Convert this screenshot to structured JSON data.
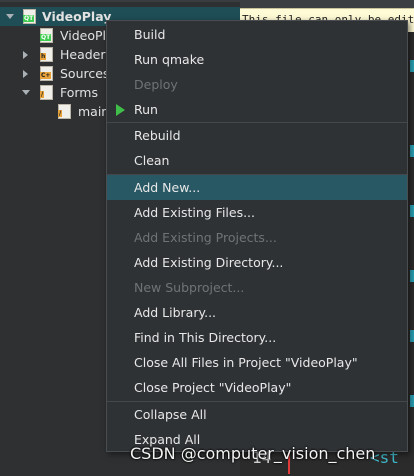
{
  "tree": {
    "project": "VideoPlay",
    "items": [
      {
        "label": "VideoPlay",
        "icon": "pro-file-icon"
      },
      {
        "label": "Headers",
        "icon": "headers-folder-icon"
      },
      {
        "label": "Sources",
        "icon": "sources-folder-icon"
      },
      {
        "label": "Forms",
        "icon": "forms-folder-icon"
      },
      {
        "label": "main",
        "icon": "ui-file-icon"
      }
    ]
  },
  "editor": {
    "banner": "This file can only be edited",
    "line_number": "14",
    "code_fragment": "<st"
  },
  "menu": {
    "items": [
      {
        "label": "Build",
        "enabled": true
      },
      {
        "label": "Run qmake",
        "enabled": true
      },
      {
        "label": "Deploy",
        "enabled": false
      },
      {
        "label": "Run",
        "enabled": true
      },
      {
        "label": "Rebuild",
        "enabled": true
      },
      {
        "label": "Clean",
        "enabled": true
      },
      {
        "label": "Add New...",
        "enabled": true,
        "highlighted": true
      },
      {
        "label": "Add Existing Files...",
        "enabled": true
      },
      {
        "label": "Add Existing Projects...",
        "enabled": false
      },
      {
        "label": "Add Existing Directory...",
        "enabled": true
      },
      {
        "label": "New Subproject...",
        "enabled": false
      },
      {
        "label": "Add Library...",
        "enabled": true
      },
      {
        "label": "Find in This Directory...",
        "enabled": true
      },
      {
        "label": "Close All Files in Project \"VideoPlay\"",
        "enabled": true
      },
      {
        "label": "Close Project \"VideoPlay\"",
        "enabled": true
      },
      {
        "label": "Collapse All",
        "enabled": true
      },
      {
        "label": "Expand All",
        "enabled": true
      }
    ]
  },
  "watermark": "CSDN @computer_vision_chen",
  "colors": {
    "selection": "#1f4e56",
    "menu_highlight": "#275864",
    "run_icon": "#3fbf4a",
    "banner_bg": "#fffbd6"
  }
}
